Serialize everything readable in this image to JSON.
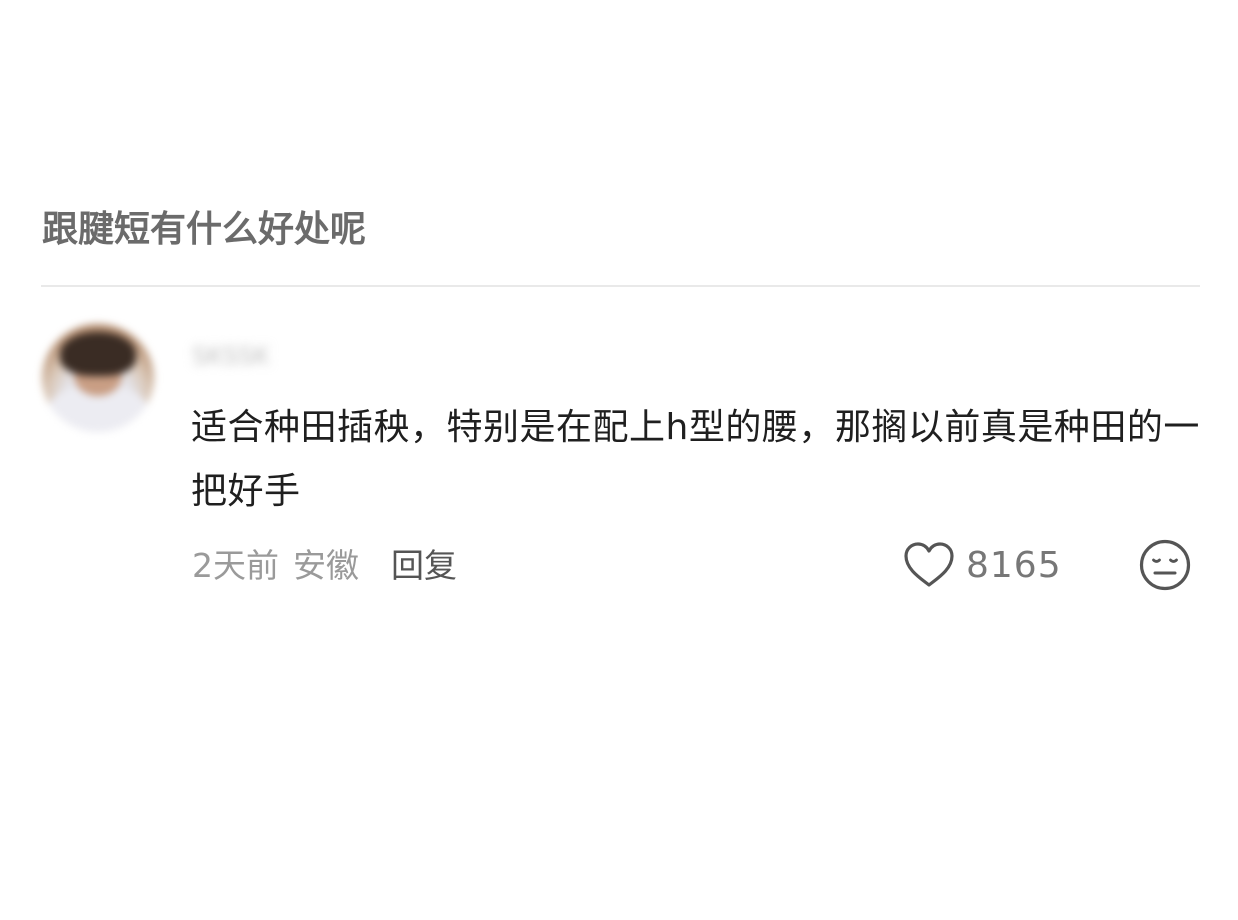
{
  "question": {
    "title": "跟腱短有什么好处呢"
  },
  "comment": {
    "username": "SKSSK",
    "text": "适合种田插秧，特别是在配上h型的腰，那搁以前真是种田的一把好手",
    "time": "2天前",
    "location": "安徽",
    "reply_label": "回复",
    "like_count": "8165",
    "like_icon": "heart-outline-icon",
    "react_icon": "neutral-face-icon"
  },
  "colors": {
    "title": "#6b6b6b",
    "text": "#1f1f1f",
    "meta": "#9a9a9a",
    "reply": "#555555",
    "icon": "#555555",
    "divider": "#e9e9e9"
  }
}
